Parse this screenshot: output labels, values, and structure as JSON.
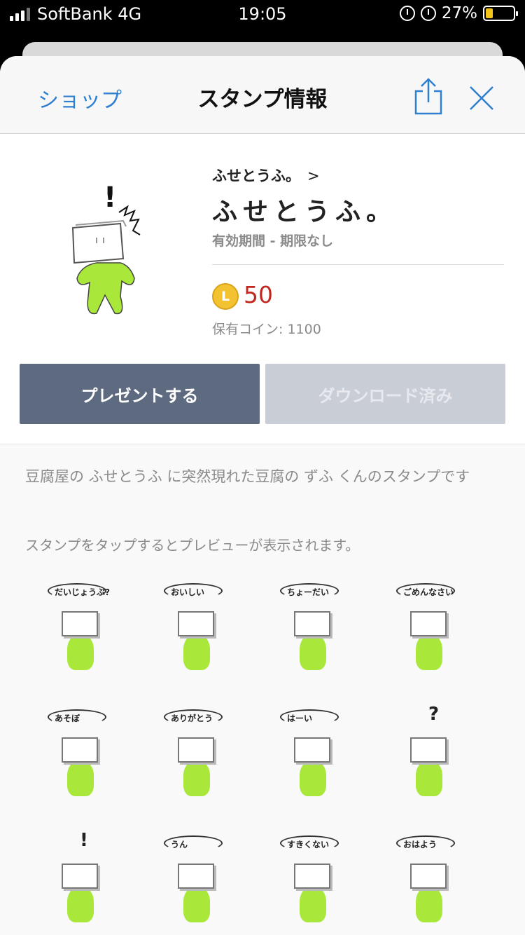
{
  "status_bar": {
    "carrier": "SoftBank 4G",
    "time": "19:05",
    "battery": "27%",
    "battery_level": 0.27
  },
  "nav": {
    "back_label": "ショップ",
    "title": "スタンプ情報"
  },
  "pack": {
    "author": "ふせとうふ。",
    "author_chevron": ">",
    "name": "ふせとうふ。",
    "validity": "有効期間 - 期限なし",
    "coin_symbol": "L",
    "price": "50",
    "held_coins": "保有コイン: 1100"
  },
  "actions": {
    "gift_label": "プレゼントする",
    "download_label": "ダウンロード済み"
  },
  "description": "豆腐屋の ふせとうふ に突然現れた豆腐の ずふ くんのスタンプです",
  "hint": "スタンプをタップするとプレビューが表示されます。",
  "stickers": [
    {
      "caption": "だいじょうぶ?"
    },
    {
      "caption": "おいしい"
    },
    {
      "caption": "ちょーだい"
    },
    {
      "caption": "ごめんなさい"
    },
    {
      "caption": "あそぼ"
    },
    {
      "caption": "ありがとう"
    },
    {
      "caption": "はーい"
    },
    {
      "caption": "?"
    },
    {
      "caption": "!"
    },
    {
      "caption": "うん"
    },
    {
      "caption": "すきくない"
    },
    {
      "caption": "おはよう"
    }
  ],
  "colors": {
    "accent_blue": "#2f7fd1",
    "price_red": "#c2281f",
    "gift_button": "#5e6a80",
    "download_button": "#c9cdd5",
    "sticker_green": "#a9e83a"
  }
}
